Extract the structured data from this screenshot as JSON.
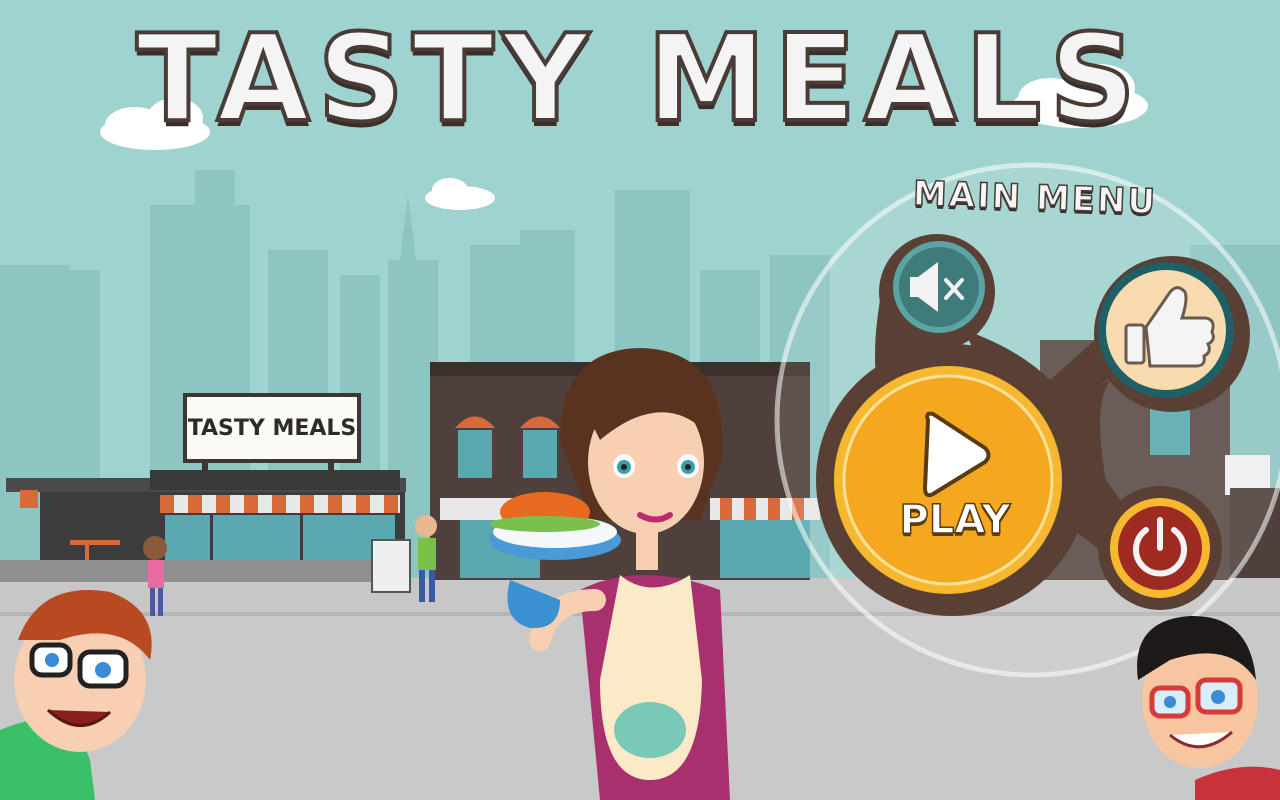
{
  "game": {
    "title": "TASTY MEALS",
    "shop_sign": "TASTY MEALS"
  },
  "main_menu": {
    "label": "MAIN MENU",
    "play_label": "PLAY",
    "buttons": {
      "sound": "mute-icon",
      "like": "thumbs-up-icon",
      "play": "play-icon",
      "power": "power-icon"
    }
  },
  "colors": {
    "sky": "#9fd3cf",
    "menu_blob": "#5a3f34",
    "play_orange": "#f4a820",
    "like_cream": "#f8dcb0",
    "sound_teal": "#3f7b7b",
    "power_red": "#9e2b22"
  }
}
